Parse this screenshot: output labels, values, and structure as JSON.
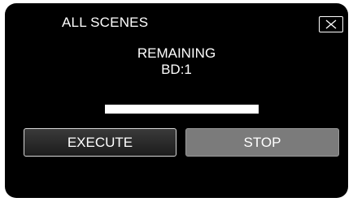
{
  "dialog": {
    "title": "ALL SCENES",
    "close_icon": "close-icon",
    "status_line_1": "REMAINING",
    "status_line_2": "BD:1",
    "buttons": {
      "execute_label": "EXECUTE",
      "stop_label": "STOP"
    },
    "colors": {
      "background": "#000000",
      "text": "#ffffff",
      "stop_button": "#7b7b7b"
    }
  }
}
